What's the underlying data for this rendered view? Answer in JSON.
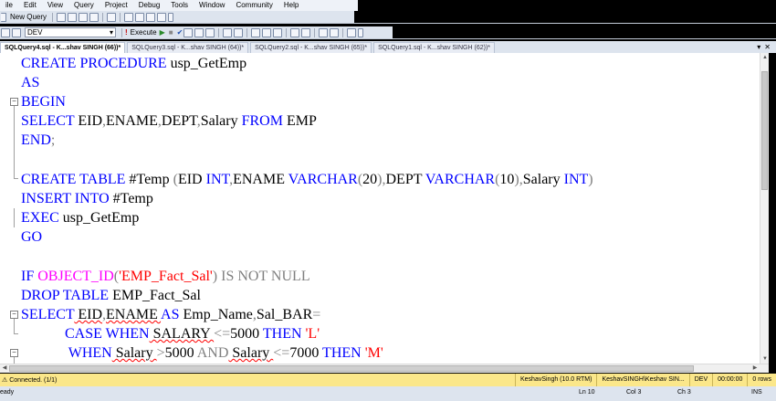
{
  "menu": [
    "ile",
    "Edit",
    "View",
    "Query",
    "Project",
    "Debug",
    "Tools",
    "Window",
    "Community",
    "Help"
  ],
  "toolbar1": {
    "new_query": "New Query"
  },
  "toolbar2": {
    "database": "DEV",
    "execute": "Execute"
  },
  "tabs": [
    "SQLQuery4.sql - K...shav SINGH (66))*",
    "SQLQuery3.sql - K...shav SINGH (64))*",
    "SQLQuery2.sql - K...shav SINGH (65))*",
    "SQLQuery1.sql - K...shav SINGH (62))*"
  ],
  "tab_controls": {
    "pin": "▾",
    "close": "✕"
  },
  "status": {
    "connection": "Connected. (1/1)",
    "server": "KeshavSingh (10.0 RTM)",
    "user": "KeshavSINGH\\Keshav SIN...",
    "database": "DEV",
    "time": "00:00:00",
    "rows": "0 rows"
  },
  "position": {
    "ready": "eady",
    "line": "Ln 10",
    "col": "Col 3",
    "ch": "Ch 3",
    "mode": "INS"
  },
  "code": {
    "l1_kw": "CREATE PROCEDURE",
    "l1_id": " usp_GetEmp",
    "l2_kw": "AS",
    "l3_kw": "BEGIN",
    "l4_kw1": "SELECT",
    "l4_id1": " EID",
    "l4_g1": ",",
    "l4_id2": "ENAME",
    "l4_g2": ",",
    "l4_id3": "DEPT",
    "l4_g3": ",",
    "l4_id4": "Salary ",
    "l4_kw2": "FROM",
    "l4_id5": " EMP",
    "l5_kw": "END",
    "l5_g": ";",
    "l7_kw": "CREATE TABLE",
    "l7_id1": " #Temp ",
    "l7_g1": "(",
    "l7_id2": "EID ",
    "l7_kw2": "INT",
    "l7_g2": ",",
    "l7_id3": "ENAME ",
    "l7_kw3": "VARCHAR",
    "l7_g3": "(",
    "l7_id4": "20",
    "l7_g4": "),",
    "l7_id5": "DEPT ",
    "l7_kw4": "VARCHAR",
    "l7_g5": "(",
    "l7_id6": "10",
    "l7_g6": "),",
    "l7_id7": "Salary ",
    "l7_kw5": "INT",
    "l7_g7": ")",
    "l8_kw": "INSERT INTO",
    "l8_id": " #Temp",
    "l9_kw": "EXEC",
    "l9_id": " usp_GetEmp",
    "l10_kw": "GO",
    "l12_kw": "IF ",
    "l12_fn": "OBJECT_ID",
    "l12_g1": "(",
    "l12_str": "'EMP_Fact_Sal'",
    "l12_g2": ")",
    "l12_g3": " IS NOT NULL",
    "l13_kw": "DROP TABLE",
    "l13_id": " EMP_Fact_Sal",
    "l14_kw": "SELECT",
    "l14_id1": " EID",
    "l14_g1": ",",
    "l14_id2": "ENAME ",
    "l14_kw2": "AS",
    "l14_id3": " Emp_Name",
    "l14_g2": ",",
    "l14_id4": "Sal_BAR",
    "l14_g3": "=",
    "l15_ind": "            ",
    "l15_kw1": "CASE WHEN",
    "l15_id1": " SALARY ",
    "l15_g1": "<=",
    "l15_id2": "5000 ",
    "l15_kw2": "THEN",
    "l15_str": " 'L'",
    "l16_ind": "             ",
    "l16_kw1": "WHEN",
    "l16_id1": " Salary ",
    "l16_g1": ">",
    "l16_id2": "5000 ",
    "l16_g2": "AND",
    "l16_id3": " Salary ",
    "l16_g3": "<=",
    "l16_id4": "7000 ",
    "l16_kw2": "THEN",
    "l16_str": " 'M'"
  }
}
